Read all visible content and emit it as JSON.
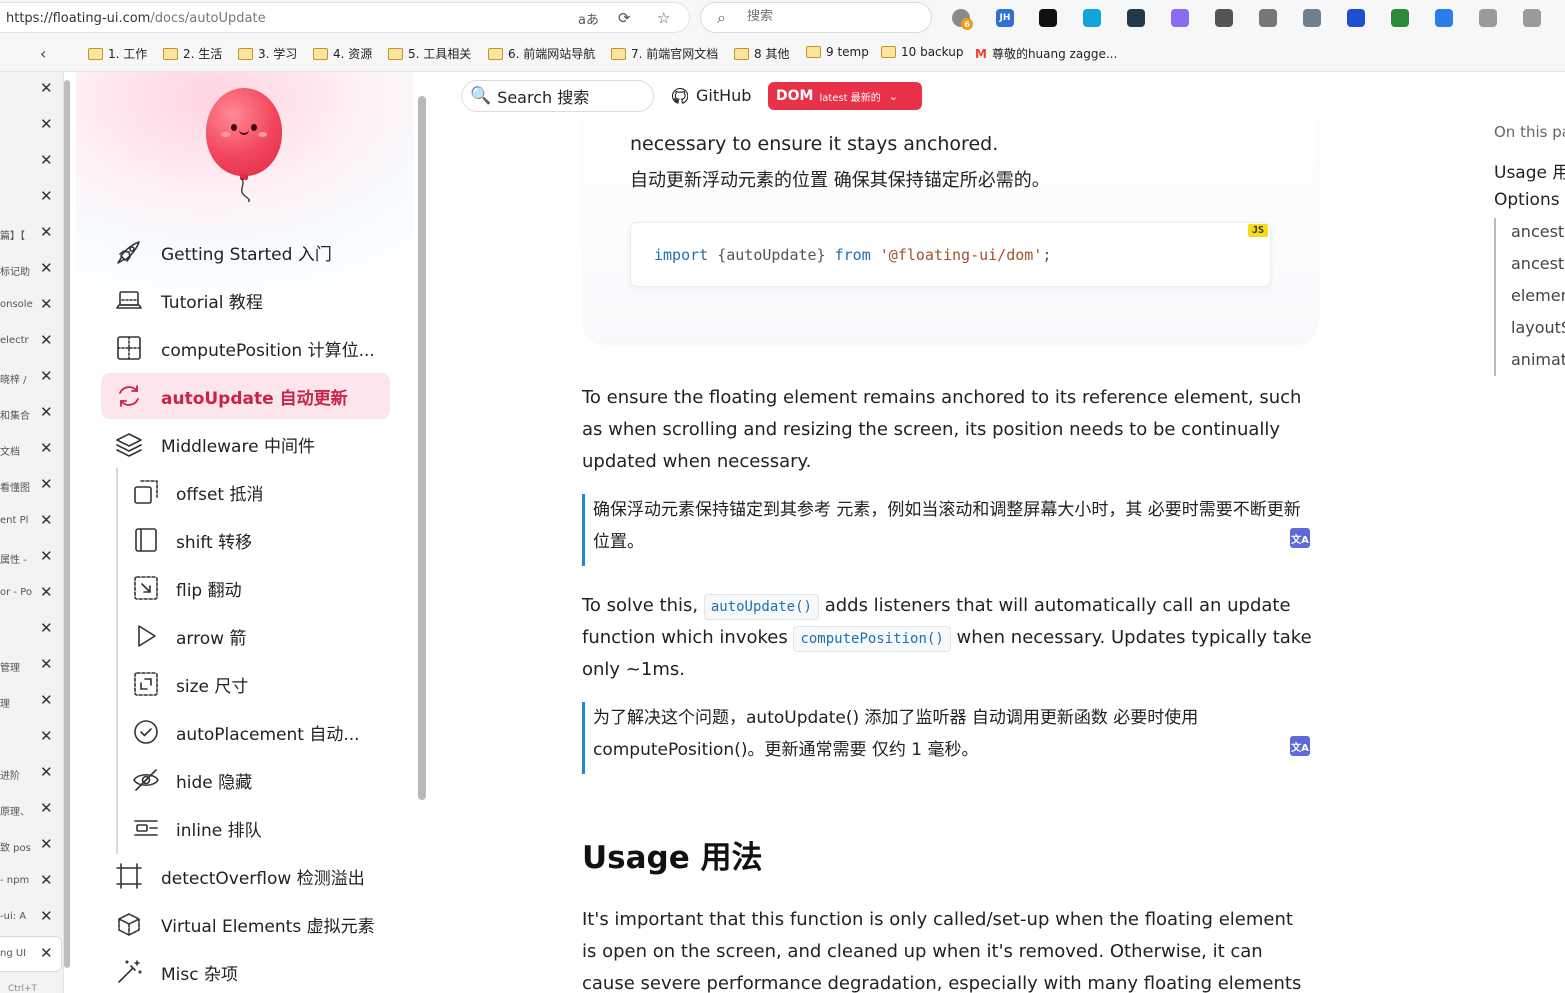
{
  "browser": {
    "url_host": "https://floating-ui.com",
    "url_path": "/docs/autoUpdate",
    "search_placeholder": "搜索",
    "ext_badge": "6",
    "extensions": [
      {
        "name": "JH",
        "color": "#2f6fd6"
      },
      {
        "name": "",
        "color": "#111111"
      },
      {
        "name": "",
        "color": "#11a4d8"
      },
      {
        "name": "",
        "color": "#203a4a"
      },
      {
        "name": "",
        "color": "#8b6cf0"
      },
      {
        "name": "",
        "color": "#555555"
      },
      {
        "name": "",
        "color": "#777777"
      },
      {
        "name": "",
        "color": "#6f7f8f"
      },
      {
        "name": "",
        "color": "#1f4fd0"
      },
      {
        "name": "",
        "color": "#2a8a3a"
      },
      {
        "name": "",
        "color": "#2b7de9"
      },
      {
        "name": "",
        "color": "#9a9a9a"
      },
      {
        "name": "",
        "color": "#9a9a9a"
      }
    ]
  },
  "bookmarks": [
    "1. 工作",
    "2. 生活",
    "3. 学习",
    "4. 资源",
    "5. 工具相关",
    "6. 前端网站导航",
    "7. 前端官网文档",
    "8 其他",
    "9 temp",
    "10 backup",
    "尊敬的huang zagge..."
  ],
  "tabs": [
    {
      "title": ""
    },
    {
      "title": ""
    },
    {
      "title": ""
    },
    {
      "title": ""
    },
    {
      "title": "篇】【"
    },
    {
      "title": "标记助"
    },
    {
      "title": "onsole"
    },
    {
      "title": "electr"
    },
    {
      "title": "晓梓 /"
    },
    {
      "title": "和集合"
    },
    {
      "title": "文档"
    },
    {
      "title": "看懂图"
    },
    {
      "title": "ent Pl"
    },
    {
      "title": "属性 - "
    },
    {
      "title": "or - Po"
    },
    {
      "title": ""
    },
    {
      "title": "管理"
    },
    {
      "title": "理"
    },
    {
      "title": ""
    },
    {
      "title": "进阶"
    },
    {
      "title": "原理、"
    },
    {
      "title": "致 pos"
    },
    {
      "title": "- npm"
    },
    {
      "title": "-ui: A"
    },
    {
      "title": "ng UI"
    }
  ],
  "tab_close_glyph": "✕",
  "new_tab_hint": "Ctrl+T",
  "docs": {
    "search_label": "Search  搜索",
    "github_label": "GitHub",
    "dom_label": "DOM",
    "dom_version": "latest  最新的",
    "nav": [
      {
        "label": "Getting Started  入门",
        "icon": "rocket-icon"
      },
      {
        "label": "Tutorial  教程",
        "icon": "laptop-icon"
      },
      {
        "label": "computePosition  计算位...",
        "icon": "grid-position-icon"
      },
      {
        "label": "autoUpdate  自动更新",
        "icon": "refresh-icon",
        "active": true
      },
      {
        "label": "Middleware  中间件",
        "icon": "layers-icon"
      }
    ],
    "middleware": [
      {
        "label": "offset  抵消",
        "icon": "offset-icon"
      },
      {
        "label": "shift  转移",
        "icon": "shift-icon"
      },
      {
        "label": "flip  翻动",
        "icon": "flip-icon"
      },
      {
        "label": "arrow  箭",
        "icon": "arrow-icon"
      },
      {
        "label": "size  尺寸",
        "icon": "size-icon"
      },
      {
        "label": "autoPlacement  自动...",
        "icon": "check-circle-icon"
      },
      {
        "label": "hide  隐藏",
        "icon": "eye-off-icon"
      },
      {
        "label": "inline  排队",
        "icon": "inline-icon"
      }
    ],
    "nav_bottom": [
      {
        "label": "detectOverflow  检测溢出",
        "icon": "overflow-icon"
      },
      {
        "label": "Virtual Elements  虚拟元素",
        "icon": "cube-icon"
      },
      {
        "label": "Misc  杂项",
        "icon": "wand-icon"
      }
    ]
  },
  "content": {
    "card_text_en": "necessary to ensure it stays anchored.",
    "card_text_zh": "自动更新浮动元素的位置 确保其保持锚定所必需的。",
    "code_lang": "JS",
    "code": {
      "kw1": "import",
      "braces": "{autoUpdate}",
      "kw2": "from",
      "str": "'@floating-ui/dom'",
      "end": ";"
    },
    "p1": "To ensure the floating element remains anchored to its reference element, such as when scrolling and resizing the screen, its position needs to be continually updated when necessary.",
    "q1": "确保浮动元素保持锚定到其参考 元素，例如当滚动和调整屏幕大小时，其 必要时需要不断更新位置。",
    "p2_a": "To solve this, ",
    "p2_code1": "autoUpdate()",
    "p2_b": " adds listeners that will automatically call an update function which invokes ",
    "p2_code2": "computePosition()",
    "p2_c": " when necessary. Updates typically take only ~1ms.",
    "q2": "为了解决这个问题，autoUpdate() 添加了监听器 自动调用更新函数 必要时使用 computePosition()。更新通常需要 仅约 1 毫秒。",
    "heading": "Usage 用法",
    "p3": "It's important that this function is only called/set-up when the floating element is open on the screen, and cleaned up when it's removed. Otherwise, it can cause severe performance degradation, especially with many floating elements being",
    "translate_glyph": "文A"
  },
  "toc": {
    "title": "On this pa",
    "items": [
      "Usage 用",
      "Options"
    ],
    "subitems": [
      "ancesto",
      "ancesto",
      "elemen",
      "layoutS",
      "animat"
    ]
  }
}
